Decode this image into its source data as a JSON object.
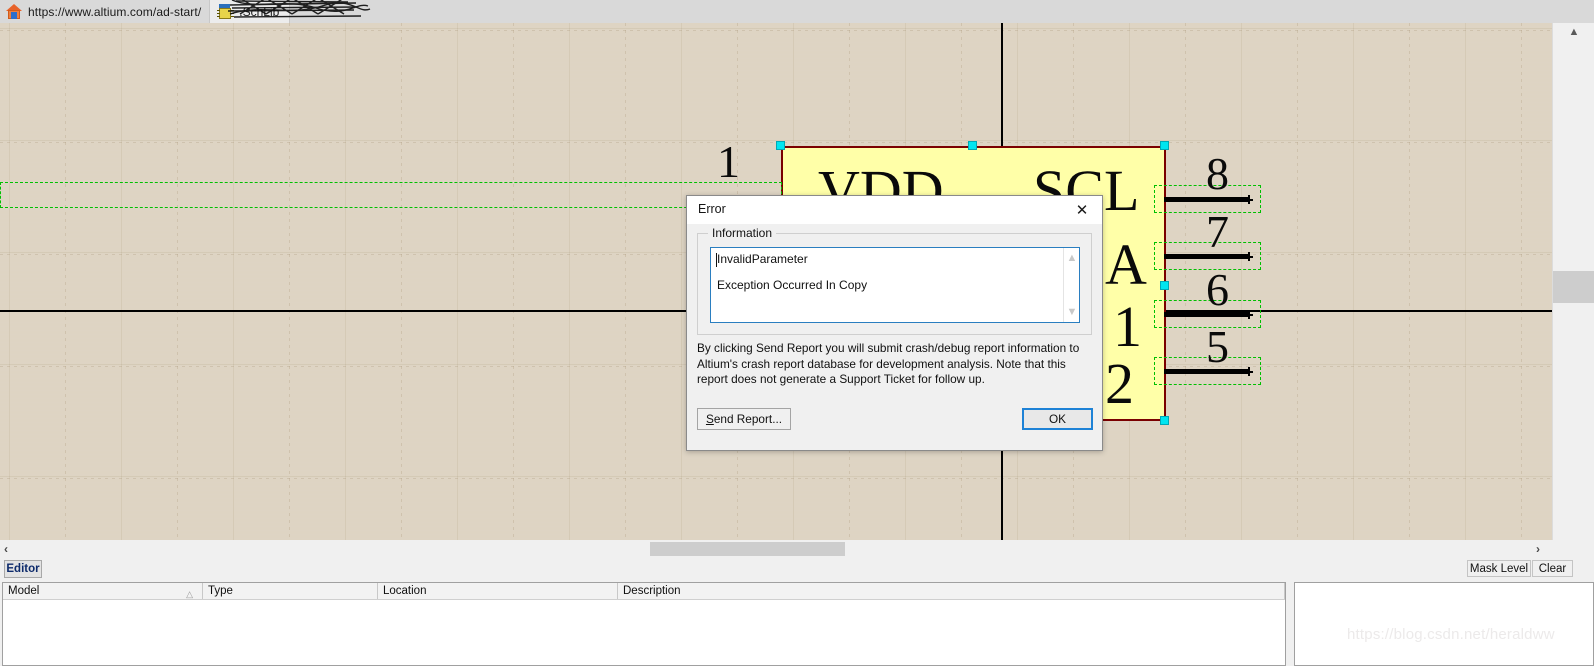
{
  "topbar": {
    "home_icon": "home-icon",
    "url": "https://www.altium.com/ad-start/",
    "document_tab": {
      "icon": "ic-chip-icon",
      "label": ".SchLib",
      "redacted": true
    }
  },
  "canvas": {
    "symbol": {
      "body_fill": "#FFFFA8",
      "body_border": "#7A0000",
      "selection_handle_color": "#00E5F0",
      "pin_selection_color": "#00C000",
      "texts": [
        "VDD",
        "SCL",
        "A",
        "1",
        "2"
      ],
      "pin_numbers_left": [
        "1"
      ],
      "pin_numbers_right": [
        "8",
        "7",
        "6",
        "5"
      ]
    }
  },
  "error_dialog": {
    "title": "Error",
    "close_icon": "close-icon",
    "group_label": "Information",
    "message_lines": [
      "InvalidParameter",
      "Exception Occurred In  Copy"
    ],
    "note": "By clicking Send Report you will submit crash/debug report information to Altium's crash report database for development analysis. Note that this report does not generate a Support Ticket for follow up.",
    "send_report_label": "Send Report...",
    "send_report_mnemonic": "S",
    "ok_label": "OK",
    "focus_color": "#1E82D6"
  },
  "bottom": {
    "editor_tab": "Editor",
    "mask_level_label": "Mask Level",
    "clear_label": "Clear",
    "collapse_left_icon": "chevron-left-icon",
    "collapse_right_icon": "chevron-right-icon",
    "models_table": {
      "columns": [
        "Model",
        "Type",
        "Location",
        "Description"
      ],
      "sort_column": "Model",
      "sort_indicator": "△",
      "rows": []
    }
  },
  "watermark": "https://blog.csdn.net/heraldww"
}
